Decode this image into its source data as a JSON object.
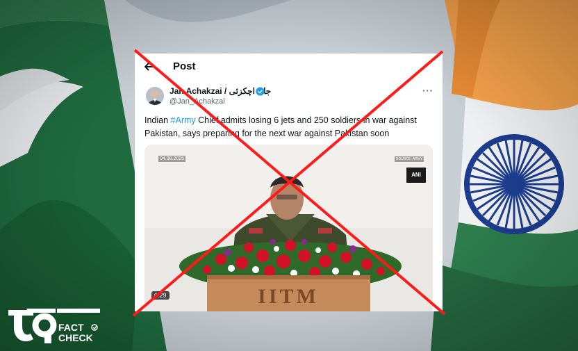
{
  "post": {
    "header_title": "Post",
    "author_name": "Jan Achakzai / جان اچکزئی",
    "author_handle": "@Jan_Achakzai",
    "more_label": "···",
    "text_before": "Indian ",
    "hashtag": "#Army",
    "text_after": " Chief admits losing 6 jets and 250 soldiers in war against Pakistan, says preparing for the next war against Pakistan soon"
  },
  "video": {
    "date": "04.08.2025",
    "source": "SOURCE: ARMY",
    "ani_logo": "ANI",
    "podium_text": "IITM",
    "duration": "0:29"
  },
  "logo": {
    "fact_line1": "FACT",
    "fact_line2": "CHECK"
  },
  "colors": {
    "cross": "#ff1a1a",
    "hashtag": "#1d9bf0",
    "verified": "#1d9bf0",
    "pakistan_green": "#1f6b3f",
    "india_saffron": "#f4a14a",
    "india_green": "#2d7d4c",
    "chakra_blue": "#1c3d8f"
  }
}
